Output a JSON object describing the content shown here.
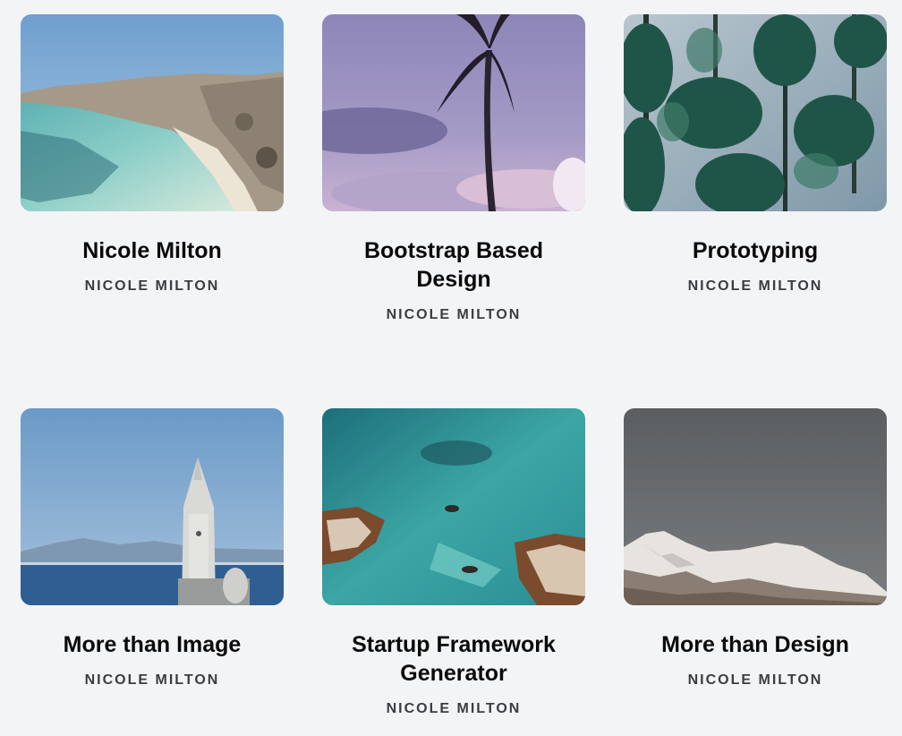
{
  "cards": [
    {
      "title": "Nicole Milton",
      "author": "NICOLE MILTON",
      "image": "beach-coast-image"
    },
    {
      "title": "Bootstrap Based Design",
      "author": "NICOLE MILTON",
      "image": "palm-tree-sky-image"
    },
    {
      "title": "Prototyping",
      "author": "NICOLE MILTON",
      "image": "palm-trees-image"
    },
    {
      "title": "More than Image",
      "author": "NICOLE MILTON",
      "image": "church-tower-sea-image"
    },
    {
      "title": "Startup Framework Generator",
      "author": "NICOLE MILTON",
      "image": "swimmers-sea-image"
    },
    {
      "title": "More than Design",
      "author": "NICOLE MILTON",
      "image": "snowy-mountain-image"
    }
  ],
  "colors": {
    "background": "#f3f4f6",
    "title": "#0a0a0a",
    "author": "#3a3d42"
  }
}
